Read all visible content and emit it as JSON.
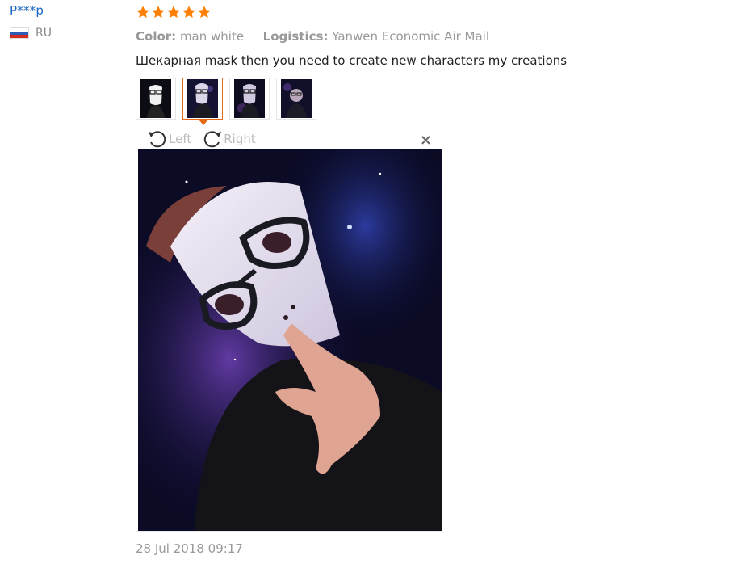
{
  "user": {
    "name": "P***p",
    "country": "RU"
  },
  "review": {
    "rating": 5,
    "color_label": "Color:",
    "color_value": "man white",
    "logistics_label": "Logistics:",
    "logistics_value": "Yanwen Economic Air Mail",
    "text": "Шекарная mask then you need to create new characters my creations",
    "thumbnails": [
      "thumbnail-1",
      "thumbnail-2",
      "thumbnail-3",
      "thumbnail-4"
    ],
    "active_thumbnail": 1,
    "date": "28 Jul 2018 09:17"
  },
  "viewer": {
    "rotate_left_label": "Left",
    "rotate_right_label": "Right",
    "close_symbol": "×"
  },
  "colors": {
    "star": "#ff7f00",
    "username": "#1a66c2",
    "active_border": "#e56a15"
  }
}
